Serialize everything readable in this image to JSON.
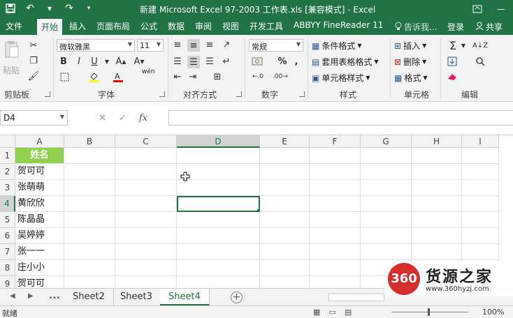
{
  "window": {
    "title": "新建 Microsoft Excel 97-2003 工作表.xls  [兼容模式] - Excel"
  },
  "tabs": [
    {
      "label": "文件"
    },
    {
      "label": "开始"
    },
    {
      "label": "插入"
    },
    {
      "label": "页面布局"
    },
    {
      "label": "公式"
    },
    {
      "label": "数据"
    },
    {
      "label": "审阅"
    },
    {
      "label": "视图"
    },
    {
      "label": "开发工具"
    },
    {
      "label": "ABBYY FineReader 11"
    }
  ],
  "tell_me": "告诉我...",
  "login": "登录",
  "share": "共享",
  "ribbon": {
    "clipboard": {
      "paste": "粘贴",
      "label": "剪贴板"
    },
    "font": {
      "name": "微软雅黑",
      "size": "11",
      "label": "字体",
      "phonetic": "wén"
    },
    "alignment": {
      "label": "对齐方式"
    },
    "number": {
      "format": "常规",
      "label": "数字"
    },
    "styles": {
      "conditional": "条件格式",
      "table": "套用表格格式",
      "cell_styles": "单元格样式",
      "label": "样式"
    },
    "cells": {
      "insert": "插入",
      "delete": "删除",
      "format": "格式",
      "label": "单元格"
    },
    "editing": {
      "label": "编辑"
    }
  },
  "formula_bar": {
    "name_box": "D4",
    "fx": "fx",
    "formula": ""
  },
  "columns": [
    "A",
    "B",
    "C",
    "D",
    "E",
    "F",
    "G",
    "H",
    "I"
  ],
  "selected_column": "D",
  "rows": [
    "1",
    "2",
    "3",
    "4",
    "5",
    "6",
    "7",
    "8",
    "9"
  ],
  "selected_row": "4",
  "cells": {
    "A1": "姓名",
    "A2": "贺可可",
    "A3": "张萌萌",
    "A4": "黄欣欣",
    "A5": "陈晶晶",
    "A6": "吴婷婷",
    "A7": "张一一",
    "A8": "庄小小",
    "A9": "贺可可"
  },
  "sheets": {
    "ellipsis": "...",
    "tabs": [
      "Sheet2",
      "Sheet3",
      "Sheet4"
    ],
    "active": "Sheet4"
  },
  "status": {
    "ready": "就绪",
    "zoom": "100%"
  },
  "watermark": {
    "badge": "360",
    "title": "货源之家",
    "url": "www.360hyzj.com"
  },
  "colors": {
    "accent": "#217346",
    "header_fill": "#92d050"
  }
}
